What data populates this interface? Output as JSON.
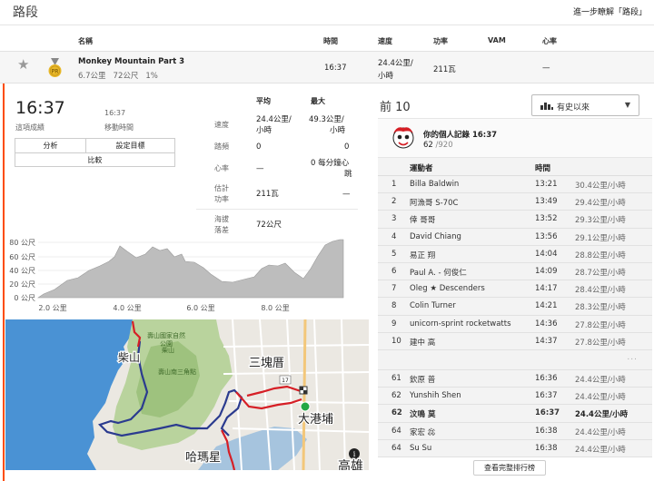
{
  "page": {
    "title": "路段",
    "more_link": "進一步瞭解「路段」"
  },
  "columns": {
    "name": "名稱",
    "time": "時間",
    "speed": "速度",
    "power": "功率",
    "vam": "VAM",
    "hr": "心率"
  },
  "segment": {
    "name": "Monkey Mountain Part 3",
    "distance": "6.7公里",
    "elevation": "72公尺",
    "grade": "1%",
    "time": "16:37",
    "speed_line1": "24.4公里/",
    "speed_line2": "小時",
    "power": "211瓦",
    "hr": "—",
    "medal": "PR",
    "star_icon": "star-icon"
  },
  "effort": {
    "time": "16:37",
    "time_label": "這項成績",
    "moving_time": "16:37",
    "moving_label": "移動時間",
    "buttons": {
      "analysis": "分析",
      "set_goal": "設定目標",
      "compare": "比較"
    }
  },
  "stats": {
    "avg_header": "平均",
    "max_header": "最大",
    "rows": [
      {
        "label": "速度",
        "avg_l1": "24.4公里/",
        "avg_l2": "小時",
        "max_l1": "49.3公里/",
        "max_l2": "小時"
      },
      {
        "label": "踏頻",
        "avg": "0",
        "max": "0"
      },
      {
        "label": "心率",
        "avg": "—",
        "max_l1": "0 每分鐘心",
        "max_l2": "跳"
      },
      {
        "label_l1": "估計",
        "label_l2": "功率",
        "avg": "211瓦",
        "max": "—"
      },
      {
        "label_l1": "海拔",
        "label_l2": "落差",
        "avg": "72公尺"
      }
    ]
  },
  "elevation_chart": {
    "y_ticks": [
      "80 公尺",
      "60 公尺",
      "40 公尺",
      "20 公尺",
      "0 公尺"
    ],
    "x_ticks": [
      "2.0 公里",
      "4.0 公里",
      "6.0 公里",
      "8.0 公里"
    ]
  },
  "map": {
    "labels": {
      "chaishan": "柴山",
      "sankuaicuo": "三塊厝",
      "dagangpu": "大港埔",
      "hamaxing": "哈瑪星",
      "kaohsiung": "高雄",
      "park1": "壽山國家自然",
      "park2": "公園",
      "park3": "柴山",
      "park4": "壽山南三角點",
      "route_no": "17"
    }
  },
  "leaderboard": {
    "title": "前 10",
    "filter": "有史以來",
    "pr_title": "你的個人記錄 16:37",
    "pr_rank": "62",
    "pr_total": "/920",
    "header_athlete": "運動者",
    "header_time": "時間",
    "rows": [
      {
        "rank": "1",
        "athlete": "Billa Baldwin",
        "time": "13:21",
        "speed": "30.4公里/小時"
      },
      {
        "rank": "2",
        "athlete": "阿漁哥 S-70C",
        "time": "13:49",
        "speed": "29.4公里/小時"
      },
      {
        "rank": "3",
        "athlete": "倖 哥哥",
        "time": "13:52",
        "speed": "29.3公里/小時"
      },
      {
        "rank": "4",
        "athlete": "David Chiang",
        "time": "13:56",
        "speed": "29.1公里/小時"
      },
      {
        "rank": "5",
        "athlete": "易正 翔",
        "time": "14:04",
        "speed": "28.8公里/小時"
      },
      {
        "rank": "6",
        "athlete": "Paul A. - 何俊仁",
        "time": "14:09",
        "speed": "28.7公里/小時"
      },
      {
        "rank": "7",
        "athlete": "Oleg ★ Descenders",
        "time": "14:17",
        "speed": "28.4公里/小時"
      },
      {
        "rank": "8",
        "athlete": "Colin Turner",
        "time": "14:21",
        "speed": "28.3公里/小時"
      },
      {
        "rank": "9",
        "athlete": "unicorn-sprint rocketwatts",
        "time": "14:36",
        "speed": "27.8公里/小時"
      },
      {
        "rank": "10",
        "athlete": "建中 高",
        "time": "14:37",
        "speed": "27.8公里/小時"
      }
    ],
    "gap": "...",
    "nearby": [
      {
        "rank": "61",
        "athlete": "欽原 普",
        "time": "16:36",
        "speed": "24.4公里/小時",
        "me": false
      },
      {
        "rank": "62",
        "athlete": "Yunshih Shen",
        "time": "16:37",
        "speed": "24.4公里/小時",
        "me": false
      },
      {
        "rank": "62",
        "athlete": "汶鳴 莫",
        "time": "16:37",
        "speed": "24.4公里/小時",
        "me": true
      },
      {
        "rank": "64",
        "athlete": "家宏 惢",
        "time": "16:38",
        "speed": "24.4公里/小時",
        "me": false
      },
      {
        "rank": "64",
        "athlete": "Su Su",
        "time": "16:38",
        "speed": "24.4公里/小時",
        "me": false
      }
    ],
    "full_button": "查看完整排行榜"
  },
  "colors": {
    "accent": "#fc4c02",
    "route_red": "#d61f26",
    "route_blue": "#2b3b8f",
    "water": "#3d8fd1",
    "park": "#c8ddb0"
  }
}
